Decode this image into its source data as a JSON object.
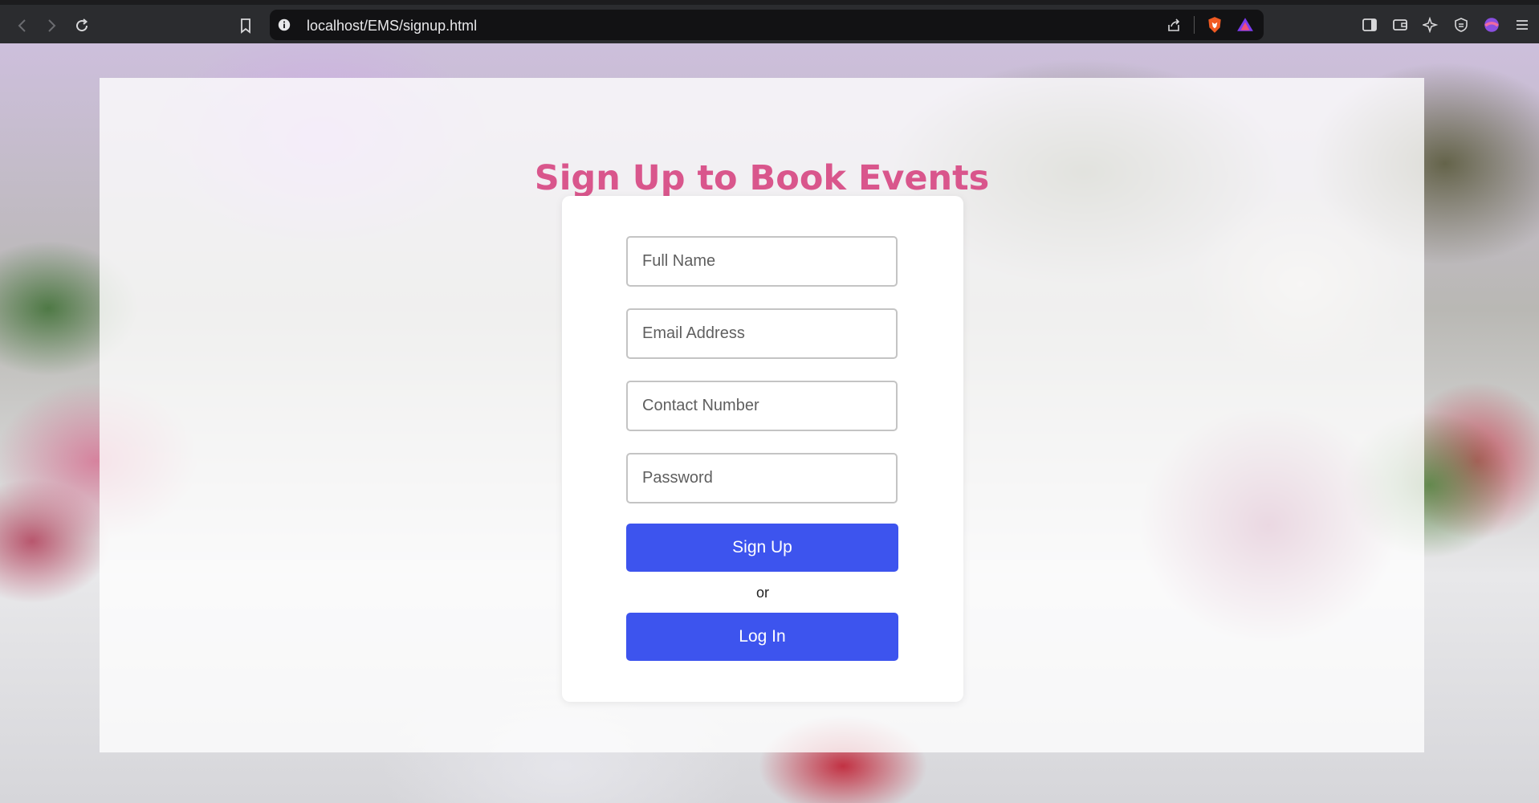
{
  "browser": {
    "url": "localhost/EMS/signup.html"
  },
  "page": {
    "title": "Sign Up to Book Events"
  },
  "form": {
    "full_name_placeholder": "Full Name",
    "email_placeholder": "Email Address",
    "contact_placeholder": "Contact Number",
    "password_placeholder": "Password",
    "signup_label": "Sign Up",
    "or_label": "or",
    "login_label": "Log In"
  },
  "colors": {
    "title": "#d9568c",
    "button": "#3d54ee"
  }
}
